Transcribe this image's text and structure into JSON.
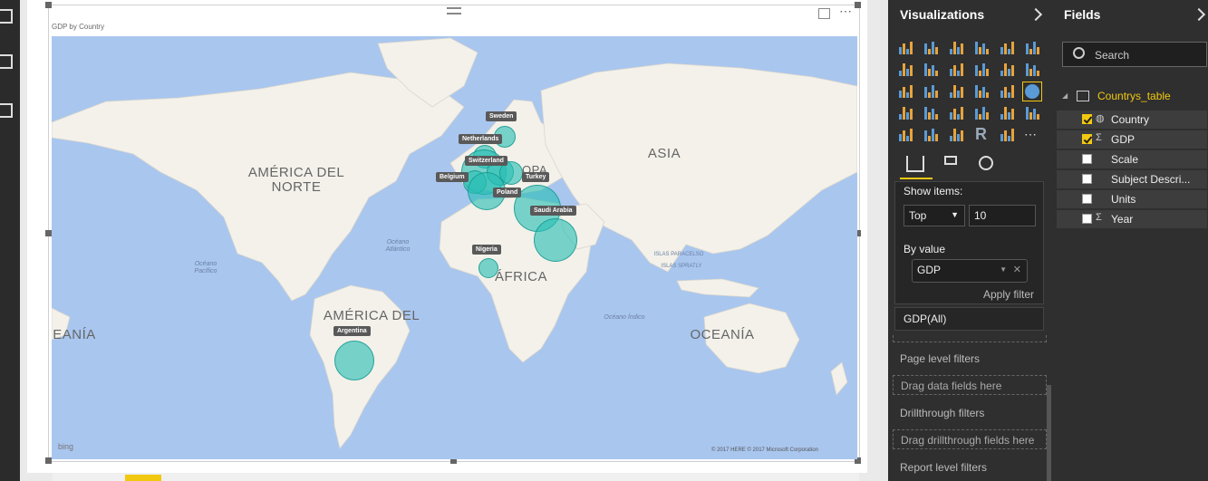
{
  "visual": {
    "title": "GDP by Country",
    "countries": [
      {
        "label": "Sweden"
      },
      {
        "label": "Netherlands"
      },
      {
        "label": "Switzerland"
      },
      {
        "label": "Turkey"
      },
      {
        "label": "Belgium"
      },
      {
        "label": "Poland"
      },
      {
        "label": "Saudi Arabia"
      },
      {
        "label": "Nigeria"
      },
      {
        "label": "Argentina"
      }
    ],
    "map_labels": {
      "na": "AMÉRICA DEL NORTE",
      "asia": "ASIA",
      "europe": "OPA",
      "africa": "ÁFRICA",
      "sa": "AMÉRICA DEL",
      "oceania": "OCEANÍA",
      "oceania_left": "EANÍA",
      "atlantic": "Océano Atlántico",
      "pacific": "Océano Pacífico",
      "indian": "Océano Índico",
      "paracel": "ISLAS PARACELSO",
      "spratly": "ISLAS SPRATLY"
    },
    "bing": "bing",
    "credits": "© 2017 HERE   © 2017 Microsoft Corporation"
  },
  "visualizations": {
    "title": "Visualizations",
    "filter": {
      "show_items_label": "Show items:",
      "top_option": "Top",
      "top_count": "10",
      "by_value_label": "By value",
      "value_field": "GDP",
      "apply": "Apply filter"
    },
    "gdp_all": "GDP(All)",
    "page_filters": "Page level filters",
    "drag_data": "Drag data fields here",
    "drillthrough": "Drillthrough filters",
    "drag_drill": "Drag drillthrough fields here",
    "report_filters": "Report level filters"
  },
  "fields": {
    "title": "Fields",
    "search_placeholder": "Search",
    "table": "Countrys_table",
    "items": [
      {
        "name": "Country",
        "checked": true,
        "icon": "globe-icon"
      },
      {
        "name": "GDP",
        "checked": true,
        "icon": "sigma-icon"
      },
      {
        "name": "Scale",
        "checked": false,
        "icon": ""
      },
      {
        "name": "Subject Descri...",
        "checked": false,
        "icon": ""
      },
      {
        "name": "Units",
        "checked": false,
        "icon": ""
      },
      {
        "name": "Year",
        "checked": false,
        "icon": "sigma-icon"
      }
    ]
  },
  "colors": {
    "accent": "#f2c811",
    "bubble": "#28beb4",
    "ocean": "#a9c6ef"
  }
}
